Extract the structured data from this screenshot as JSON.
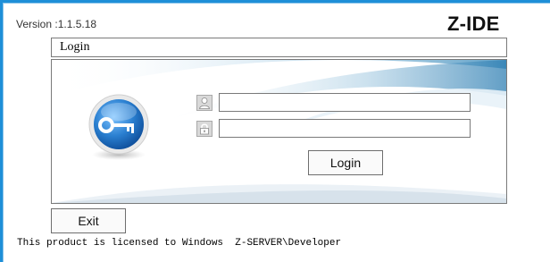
{
  "app": {
    "version_text": "Version :1.1.5.18",
    "brand": "Z-IDE"
  },
  "login": {
    "header_title": "Login",
    "username_value": "",
    "password_value": "",
    "login_button_label": "Login"
  },
  "footer": {
    "exit_button_label": "Exit",
    "license_text": "This product is licensed to Windows  Z-SERVER\\Developer"
  },
  "icons": {
    "key": "key-icon",
    "user": "user-icon",
    "lock": "lock-icon"
  },
  "colors": {
    "desktop": "#1e8fd8",
    "key_orb": "#2a7fd0",
    "swoosh": "#5fa3c8",
    "border": "#7a7a7a"
  }
}
